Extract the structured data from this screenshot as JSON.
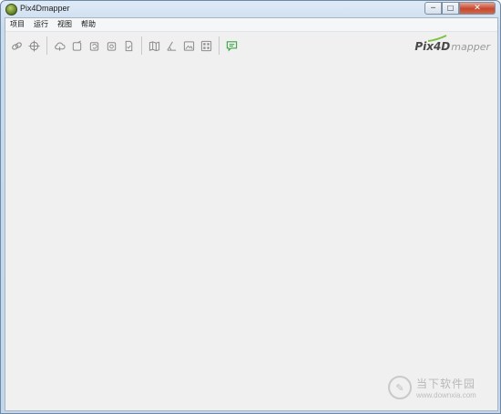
{
  "window": {
    "title": "Pix4Dmapper"
  },
  "controls": {
    "minimize": "─",
    "maximize": "□",
    "close": "✕"
  },
  "menu": {
    "items": [
      "项目",
      "运行",
      "视图",
      "帮助"
    ]
  },
  "toolbar": {
    "groups": [
      [
        "link-icon",
        "crosshair-icon"
      ],
      [
        "cloud-icon",
        "square-icon",
        "square-refresh-icon",
        "gear-box-icon",
        "file-check-icon"
      ],
      [
        "map-icon",
        "angle-icon",
        "image-icon",
        "grid-icon"
      ],
      [
        "comment-icon"
      ]
    ],
    "accent": "#3aa545",
    "icon_color": "#8c8c8c"
  },
  "logo": {
    "brand": "Pix4D",
    "suffix": "mapper",
    "accent": "#7cc242"
  },
  "watermark": {
    "title": "当下软件园",
    "url": "www.downxia.com"
  }
}
